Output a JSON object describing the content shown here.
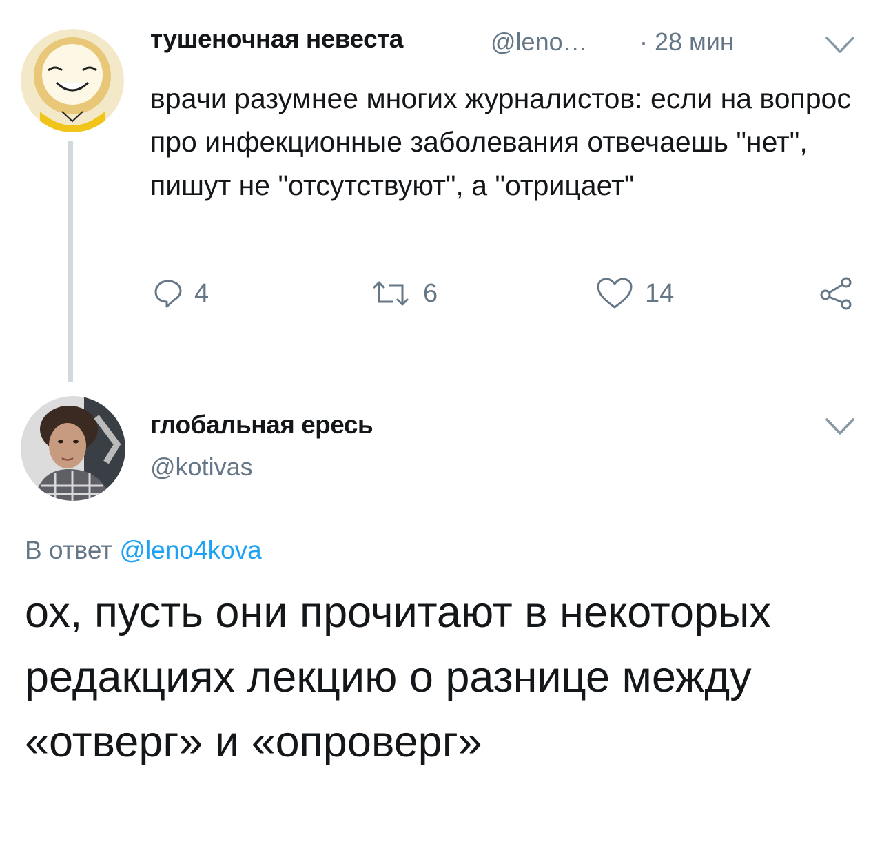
{
  "tweet1": {
    "display_name": "тушеночная невеста",
    "handle": "@leno…",
    "time": "· 28 мин",
    "text": "врачи разумнее многих журналистов: если на вопрос про инфекционные заболевания отвечаешь \"нет\", пишут не \"отсутствуют\", а \"отрицает\"",
    "actions": {
      "reply_count": "4",
      "retweet_count": "6",
      "like_count": "14"
    },
    "avatar_icon": "cartoon-face-avatar"
  },
  "tweet2": {
    "display_name": "глобальная ересь",
    "handle": "@kotivas",
    "reply_prefix": "В ответ ",
    "reply_mention": "@leno4kova",
    "text": "ох, пусть они прочитают в некоторых редакциях лекцию о разнице между «отверг» и «опроверг»",
    "avatar_icon": "photo-avatar"
  },
  "colors": {
    "text": "#14171a",
    "secondary": "#657786",
    "link": "#1da1f2",
    "thread_line": "#cfd9de"
  }
}
